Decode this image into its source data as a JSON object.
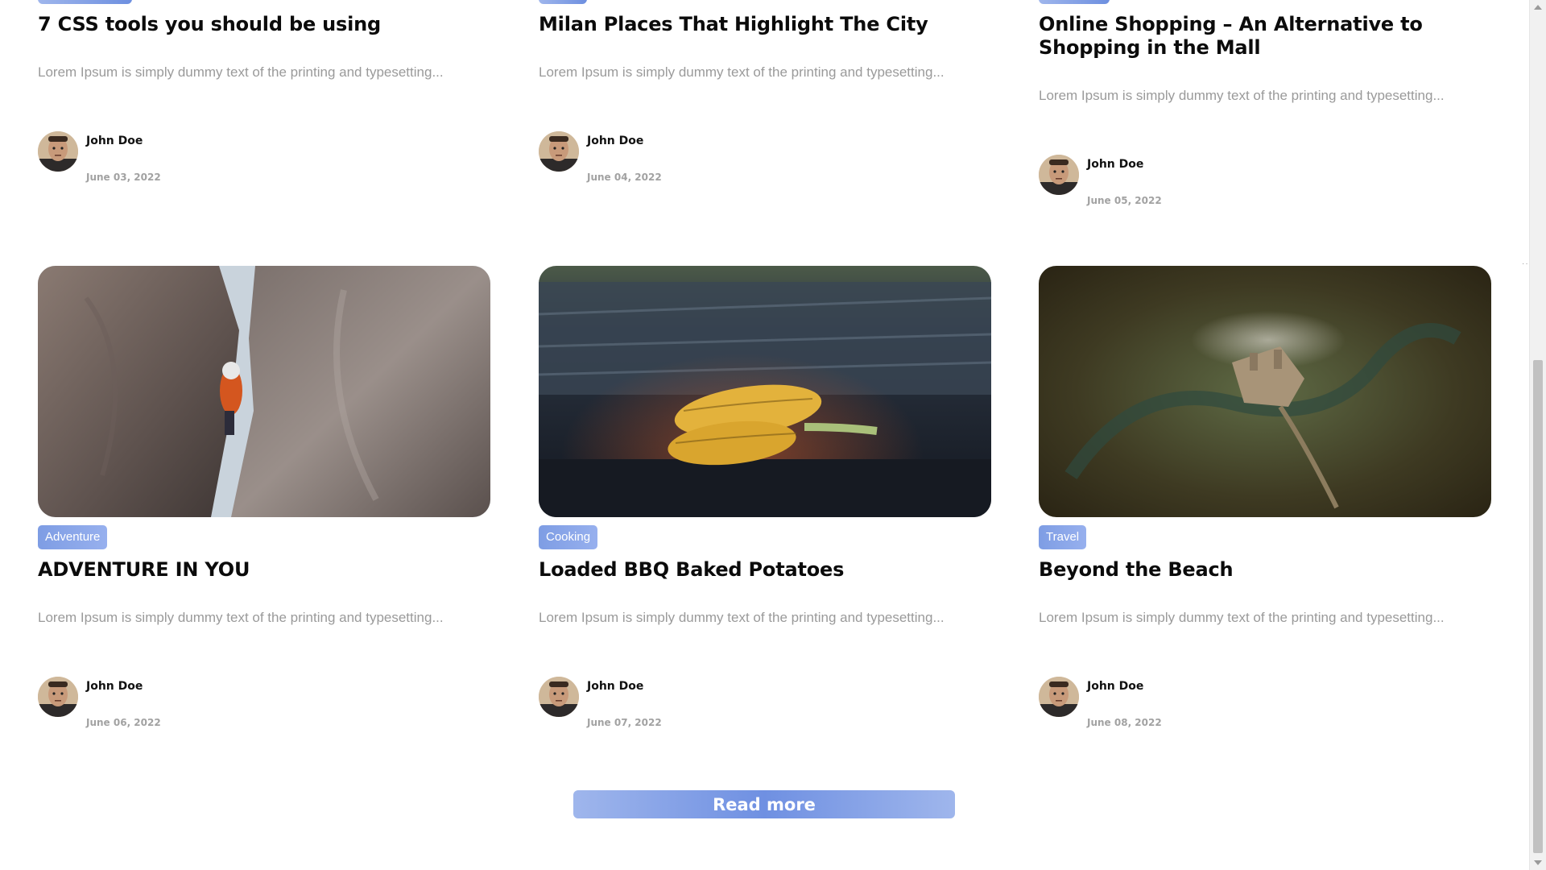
{
  "top_row": [
    {
      "title": "7 CSS tools you should be using",
      "excerpt": "Lorem Ipsum is simply dummy text of the printing and typesetting...",
      "author": "John Doe",
      "date": "June 03, 2022"
    },
    {
      "title": "Milan Places That Highlight The City",
      "excerpt": "Lorem Ipsum is simply dummy text of the printing and typesetting...",
      "author": "John Doe",
      "date": "June 04, 2022"
    },
    {
      "title": "Online Shopping – An Alternative to Shopping in the Mall",
      "excerpt": "Lorem Ipsum is simply dummy text of the printing and typesetting...",
      "author": "John Doe",
      "date": "June 05, 2022"
    }
  ],
  "bottom_row": [
    {
      "image": "rock-climber-in-crevice",
      "category": "Adventure",
      "title": "ADVENTURE IN YOU",
      "excerpt": "Lorem Ipsum is simply dummy text of the printing and typesetting...",
      "author": "John Doe",
      "date": "June 06, 2022"
    },
    {
      "image": "grilled-corn-on-bbq",
      "category": "Cooking",
      "title": "Loaded BBQ Baked Potatoes",
      "excerpt": "Lorem Ipsum is simply dummy text of the printing and typesetting...",
      "author": "John Doe",
      "date": "June 07, 2022"
    },
    {
      "image": "aerial-castle-in-forest",
      "category": "Travel",
      "title": "Beyond the Beach",
      "excerpt": "Lorem Ipsum is simply dummy text of the printing and typesetting...",
      "author": "John Doe",
      "date": "June 08, 2022"
    }
  ],
  "read_more_label": "Read more",
  "colors": {
    "accent_light": "#9fb6ec",
    "accent": "#6f90e2",
    "title_text": "#0b0b0b",
    "muted_text": "#9a9a9a"
  }
}
